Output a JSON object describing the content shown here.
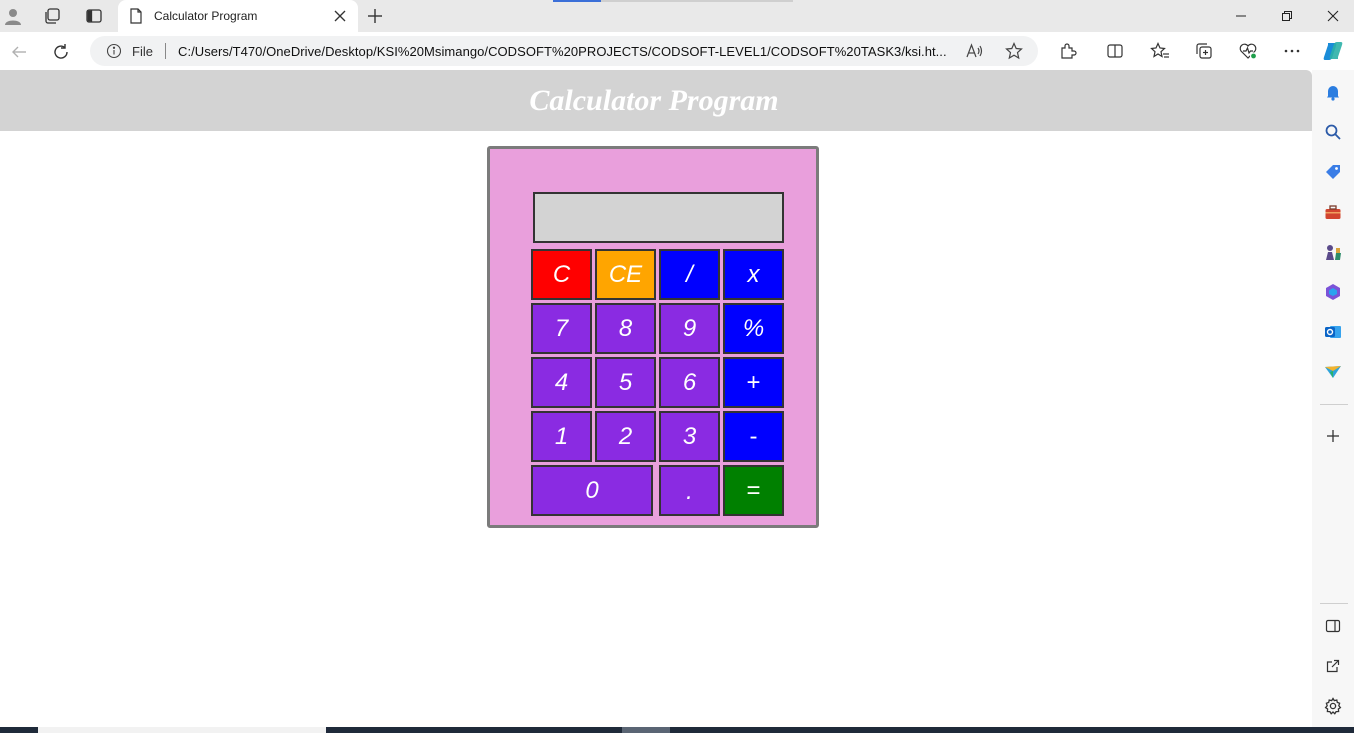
{
  "browser": {
    "tab_title": "Calculator Program",
    "address": {
      "scheme_label": "File",
      "url": "C:/Users/T470/OneDrive/Desktop/KSI%20Msimango/CODSOFT%20PROJECTS/CODSOFT-LEVEL1/CODSOFT%20TASK3/ksi.ht..."
    },
    "read_aloud_label": "A⁾"
  },
  "page": {
    "title": "Calculator Program"
  },
  "calculator": {
    "display_value": "",
    "keys": [
      {
        "label": "C",
        "color": "#ff0000"
      },
      {
        "label": "CE",
        "color": "#ffa500"
      },
      {
        "label": "/",
        "color": "#0000ff"
      },
      {
        "label": "x",
        "color": "#0000ff"
      },
      {
        "label": "7",
        "color": "#8a2be2"
      },
      {
        "label": "8",
        "color": "#8a2be2"
      },
      {
        "label": "9",
        "color": "#8a2be2"
      },
      {
        "label": "%",
        "color": "#0000ff"
      },
      {
        "label": "4",
        "color": "#8a2be2"
      },
      {
        "label": "5",
        "color": "#8a2be2"
      },
      {
        "label": "6",
        "color": "#8a2be2"
      },
      {
        "label": "+",
        "color": "#0000ff"
      },
      {
        "label": "1",
        "color": "#8a2be2"
      },
      {
        "label": "2",
        "color": "#8a2be2"
      },
      {
        "label": "3",
        "color": "#8a2be2"
      },
      {
        "label": "-",
        "color": "#0000ff"
      },
      {
        "label": "0",
        "color": "#8a2be2"
      },
      {
        "label": ".",
        "color": "#8a2be2"
      },
      {
        "label": "=",
        "color": "#008000"
      }
    ],
    "body_color": "#e99fdc",
    "display_color": "#d3d3d3"
  },
  "icons": {
    "profile": "profile-icon",
    "workspaces": "workspaces-icon",
    "tab_actions": "vertical-tabs-icon",
    "page": "page-icon",
    "close": "close-icon",
    "new_tab": "plus-icon",
    "back": "back-arrow-icon",
    "refresh": "refresh-icon",
    "info": "info-icon",
    "favorite": "star-icon",
    "extensions": "puzzle-icon",
    "split": "split-screen-icon",
    "favorites": "favorites-icon",
    "collections": "collections-icon",
    "health": "browser-essentials-icon",
    "menu": "more-icon",
    "copilot": "copilot-icon"
  }
}
